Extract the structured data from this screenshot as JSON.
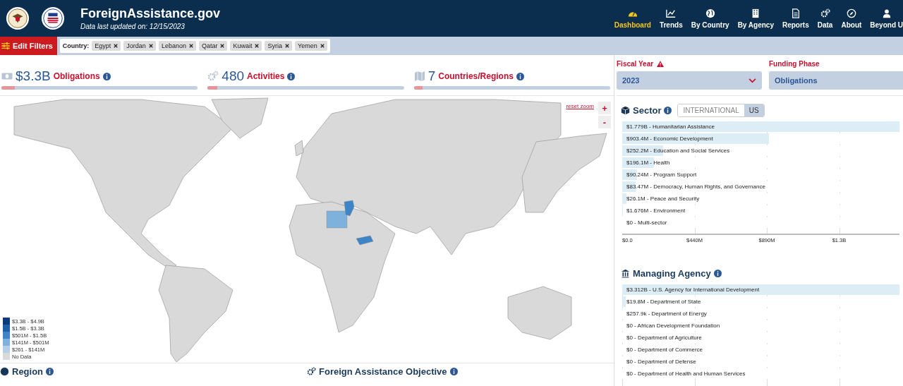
{
  "header": {
    "title": "ForeignAssistance.gov",
    "subtitle": "Data last updated on: 12/15/2023"
  },
  "nav": [
    {
      "label": "Dashboard",
      "selected": true
    },
    {
      "label": "Trends",
      "selected": false
    },
    {
      "label": "By Country",
      "selected": false
    },
    {
      "label": "By Agency",
      "selected": false
    },
    {
      "label": "Reports",
      "selected": false
    },
    {
      "label": "Data",
      "selected": false
    },
    {
      "label": "About",
      "selected": false
    },
    {
      "label": "Beyond U",
      "selected": false
    }
  ],
  "filters": {
    "button": "Edit Filters",
    "label": "Country:",
    "chips": [
      "Egypt",
      "Jordan",
      "Lebanon",
      "Qatar",
      "Kuwait",
      "Syria",
      "Yemen"
    ]
  },
  "stats": [
    {
      "value": "$3.3B",
      "label": "Obligations",
      "level": 0.07
    },
    {
      "value": "480",
      "label": "Activities",
      "level": 0.05
    },
    {
      "value": "7",
      "label": "Countries/Regions",
      "level": 0.045
    }
  ],
  "fiscal_year": {
    "label": "Fiscal Year",
    "value": "2023",
    "warning": true
  },
  "funding_phase": {
    "label": "Funding Phase",
    "value": "Obligations"
  },
  "map": {
    "reset": "reset zoom",
    "zoom_in": "+",
    "zoom_out": "-",
    "shaded_areas": [
      {
        "color": "#7fb1dd"
      },
      {
        "color": "#3d85c6"
      },
      {
        "color": "#3d85c6"
      }
    ],
    "legend": [
      {
        "label": "$3.3B - $4.9B",
        "color": "#0d3a7a"
      },
      {
        "label": "$1.5B - $3.3B",
        "color": "#1f5fa6"
      },
      {
        "label": "$501M - $1.5B",
        "color": "#3d85c6"
      },
      {
        "label": "$141M - $501M",
        "color": "#7fb1dd"
      },
      {
        "label": "$261 - $141M",
        "color": "#b4cfe8"
      },
      {
        "label": "No Data",
        "color": "#d9d9d9"
      }
    ]
  },
  "sector": {
    "title": "Sector",
    "toggle": [
      {
        "label": "INTERNATIONAL",
        "selected": false
      },
      {
        "label": "US",
        "selected": true
      }
    ],
    "rows": [
      {
        "label": "$1.779B - Humanitarian Assistance",
        "level": 1
      },
      {
        "label": "$903.4M - Economic Development",
        "level": 0.53
      },
      {
        "label": "$252.2M - Education and Social Services",
        "level": 0.148
      },
      {
        "label": "$196.1M - Health",
        "level": 0.115
      },
      {
        "label": "$90.24M - Program Support",
        "level": 0.053
      },
      {
        "label": "$83.47M - Democracy, Human Rights, and Governance",
        "level": 0.049
      },
      {
        "label": "$26.1M - Peace and Security",
        "level": 0.015
      },
      {
        "label": "$1.676M - Environment",
        "level": 0.001
      },
      {
        "label": "$0 - Multi-sector"
      }
    ],
    "axis_ticks": [
      "$0.0",
      "$440M",
      "$890M",
      "$1.3B"
    ]
  },
  "managing_agency": {
    "title": "Managing Agency",
    "rows": [
      {
        "label": "$3.312B - U.S. Agency for International Development",
        "level": 1
      },
      {
        "label": "$19.8M - Department of State",
        "level": 0.012
      },
      {
        "label": "$257.9k - Department of Energy"
      },
      {
        "label": "$0 - African Development Foundation"
      },
      {
        "label": "$0 - Department of Agriculture"
      },
      {
        "label": "$0 - Department of Commerce"
      },
      {
        "label": "$0 - Department of Defense"
      },
      {
        "label": "$0 - Department of Health and Human Services"
      }
    ]
  },
  "bottom_sections": [
    {
      "title": "Region"
    },
    {
      "title": "Foreign Assistance Objective"
    }
  ]
}
